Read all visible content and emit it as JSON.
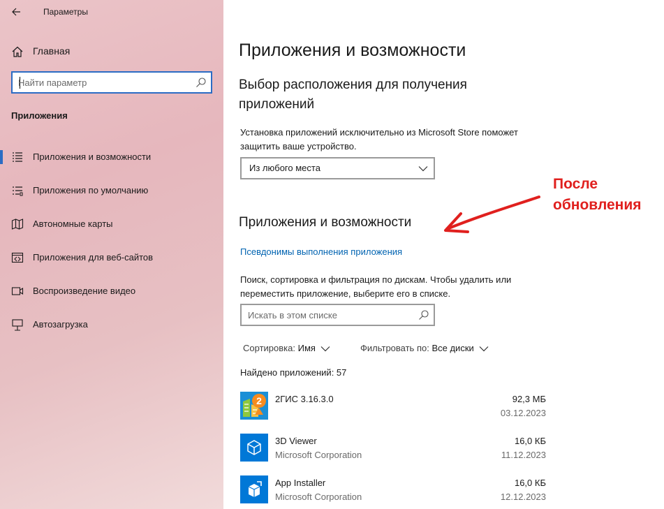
{
  "window": {
    "title": "Параметры"
  },
  "sidebar": {
    "home_label": "Главная",
    "search_placeholder": "Найти параметр",
    "section_title": "Приложения",
    "items": [
      {
        "label": "Приложения и возможности",
        "icon": "apps-list-icon",
        "active": true
      },
      {
        "label": "Приложения по умолчанию",
        "icon": "default-apps-icon",
        "active": false
      },
      {
        "label": "Автономные карты",
        "icon": "map-icon",
        "active": false
      },
      {
        "label": "Приложения для веб-сайтов",
        "icon": "web-apps-icon",
        "active": false
      },
      {
        "label": "Воспроизведение видео",
        "icon": "video-icon",
        "active": false
      },
      {
        "label": "Автозагрузка",
        "icon": "startup-icon",
        "active": false
      }
    ]
  },
  "main": {
    "title": "Приложения и возможности",
    "install_source": {
      "heading": "Выбор расположения для получения приложений",
      "description": "Установка приложений исключительно из Microsoft Store поможет защитить ваше устройство.",
      "selected": "Из любого места"
    },
    "apps": {
      "heading": "Приложения и возможности",
      "aliases_link": "Псевдонимы выполнения приложения",
      "description": "Поиск, сортировка и фильтрация по дискам. Чтобы удалить или переместить приложение, выберите его в списке.",
      "search_placeholder": "Искать в этом списке",
      "sort_label": "Сортировка:",
      "sort_value": "Имя",
      "filter_label": "Фильтровать по:",
      "filter_value": "Все диски",
      "found_text": "Найдено приложений: 57",
      "list": [
        {
          "name": "2ГИС 3.16.3.0",
          "publisher": "",
          "size": "92,3 МБ",
          "date": "03.12.2023",
          "icon": "2gis-icon"
        },
        {
          "name": "3D Viewer",
          "publisher": "Microsoft Corporation",
          "size": "16,0 КБ",
          "date": "11.12.2023",
          "icon": "3d-viewer-icon"
        },
        {
          "name": "App Installer",
          "publisher": "Microsoft Corporation",
          "size": "16,0 КБ",
          "date": "12.12.2023",
          "icon": "app-installer-icon"
        }
      ]
    }
  },
  "annotation": {
    "line1": "После",
    "line2": "обновления",
    "color": "#e0201e"
  },
  "colors": {
    "accent": "#2b6cc4",
    "link": "#0063b1",
    "tile": "#0078d7"
  }
}
